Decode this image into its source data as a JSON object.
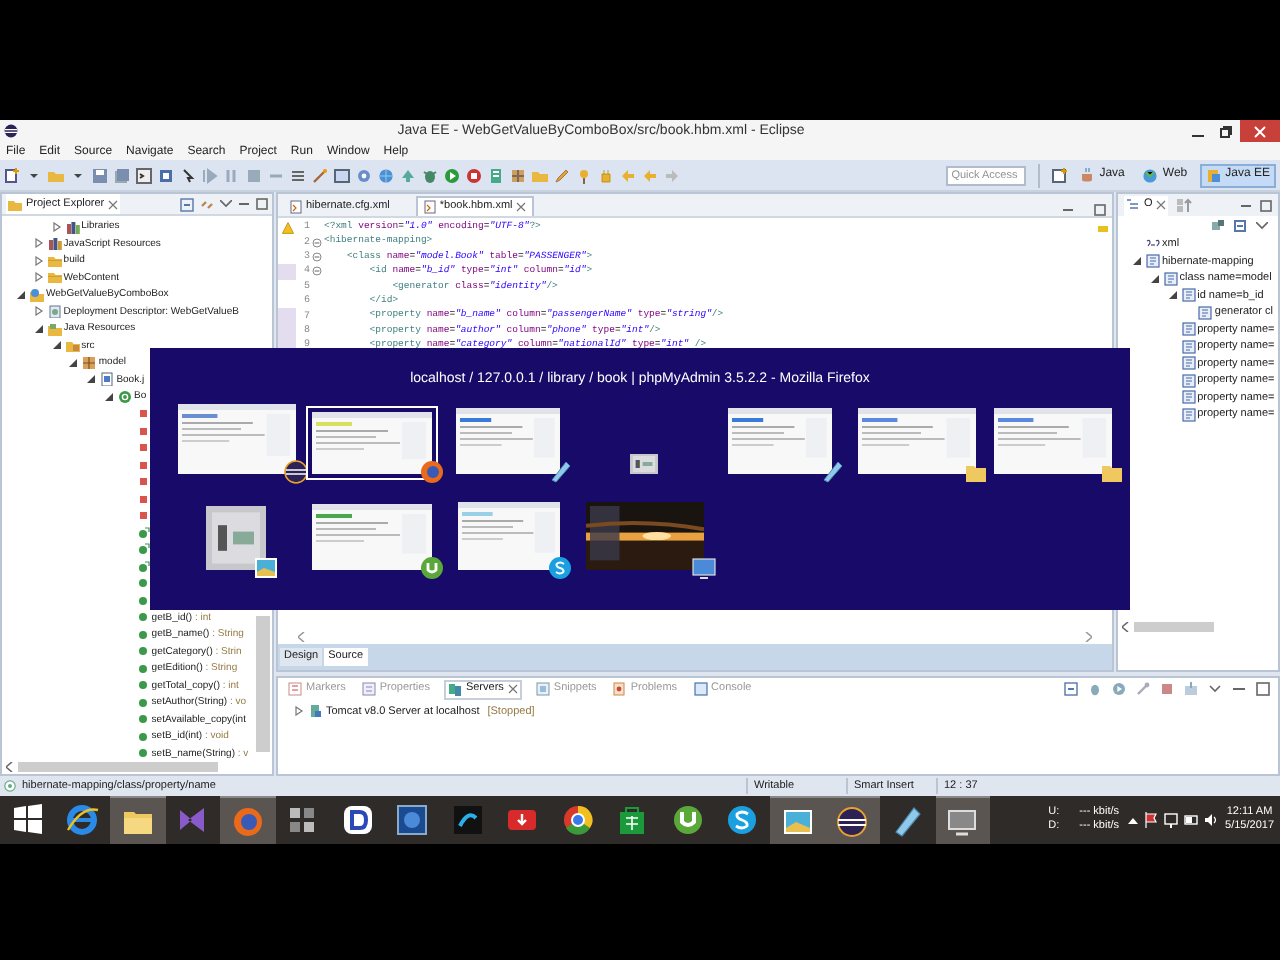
{
  "window": {
    "title": "Java EE - WebGetValueByComboBox/src/book.hbm.xml - Eclipse"
  },
  "menu": [
    "File",
    "Edit",
    "Source",
    "Navigate",
    "Search",
    "Project",
    "Run",
    "Window",
    "Help"
  ],
  "quick_access": {
    "placeholder": "Quick Access"
  },
  "perspectives": [
    {
      "label": "Java",
      "kind": "java",
      "selected": false
    },
    {
      "label": "Web",
      "kind": "web",
      "selected": false
    },
    {
      "label": "Java EE",
      "kind": "javaee",
      "selected": true
    }
  ],
  "project_explorer": {
    "title": "Project Explorer",
    "tree": [
      {
        "children": [
          {
            "children": [
              {
                "label": "Libraries",
                "kind": "library",
                "expanded": false
              }
            ]
          },
          {
            "label": "JavaScript Resources",
            "kind": "jsres",
            "expanded": false
          },
          {
            "label": "build",
            "kind": "folder",
            "expanded": false
          },
          {
            "label": "WebContent",
            "kind": "folder",
            "expanded": false
          }
        ]
      },
      {
        "label": "WebGetValueByComboBox",
        "kind": "project",
        "expanded": true,
        "children": [
          {
            "label": "Deployment Descriptor: WebGetValueB",
            "kind": "descriptor",
            "expanded": false
          },
          {
            "label": "Java Resources",
            "kind": "javares",
            "expanded": true,
            "children": [
              {
                "label": "src",
                "kind": "src",
                "expanded": true,
                "children": [
                  {
                    "label": "model",
                    "kind": "package",
                    "expanded": true,
                    "children": [
                      {
                        "label": "Book.j",
                        "kind": "javafile",
                        "expanded": true,
                        "children": [
                          {
                            "label": "Bo",
                            "kind": "class",
                            "expanded": true,
                            "children": [
                              {
                                "kind": "field"
                              },
                              {
                                "kind": "field"
                              },
                              {
                                "kind": "field"
                              },
                              {
                                "kind": "field"
                              },
                              {
                                "kind": "field"
                              },
                              {
                                "kind": "field"
                              },
                              {
                                "kind": "field"
                              },
                              {
                                "kind": "constructor"
                              },
                              {
                                "kind": "constructor"
                              },
                              {
                                "kind": "constructor"
                              },
                              {
                                "kind": "method"
                              },
                              {
                                "kind": "method"
                              },
                              {
                                "kind": "method",
                                "label": "getB_id()",
                                "type": " : int"
                              },
                              {
                                "kind": "method",
                                "label": "getB_name()",
                                "type": " : String"
                              },
                              {
                                "kind": "method",
                                "label": "getCategory()",
                                "type": " : Strin"
                              },
                              {
                                "kind": "method",
                                "label": "getEdition()",
                                "type": " : String"
                              },
                              {
                                "kind": "method",
                                "label": "getTotal_copy()",
                                "type": " : int"
                              },
                              {
                                "kind": "method",
                                "label": "setAuthor(String)",
                                "type": " : vo"
                              },
                              {
                                "kind": "method",
                                "label": "setAvailable_copy(int"
                              },
                              {
                                "kind": "method",
                                "label": "setB_id(int)",
                                "type": " : void"
                              },
                              {
                                "kind": "method",
                                "label": "setB_name(String)",
                                "type": " : v"
                              }
                            ]
                          }
                        ]
                      }
                    ]
                  }
                ]
              }
            ]
          }
        ]
      }
    ]
  },
  "editor": {
    "tabs": [
      {
        "label": "hibernate.cfg.xml",
        "selected": false
      },
      {
        "label": "*book.hbm.xml",
        "selected": true
      }
    ],
    "lines": [
      {
        "number": "1",
        "text": "<?xml version=\"1.0\" encoding=\"UTF-8\"?>",
        "warning": true,
        "fold": false,
        "changed": false
      },
      {
        "number": "2",
        "text": "<hibernate-mapping>",
        "warning": false,
        "fold": true,
        "changed": false
      },
      {
        "number": "3",
        "text": "    <class name=\"model.Book\" table=\"PASSENGER\">",
        "warning": false,
        "fold": true,
        "changed": false
      },
      {
        "number": "4",
        "text": "        <id name=\"b_id\" type=\"int\" column=\"id\">",
        "warning": false,
        "fold": true,
        "changed": true
      },
      {
        "number": "5",
        "text": "            <generator class=\"identity\"/>",
        "warning": false,
        "fold": false,
        "changed": false
      },
      {
        "number": "6",
        "text": "        </id>",
        "warning": false,
        "fold": false,
        "changed": false
      },
      {
        "number": "7",
        "text": "        <property name=\"b_name\" column=\"passengerName\" type=\"string\"/>",
        "warning": false,
        "fold": false,
        "changed": true
      },
      {
        "number": "8",
        "text": "        <property name=\"author\" column=\"phone\" type=\"int\"/>",
        "warning": false,
        "fold": false,
        "changed": true
      },
      {
        "number": "9",
        "text": "        <property name=\"category\" column=\"nationalId\" type=\"int\" />",
        "warning": false,
        "fold": false,
        "changed": true
      }
    ],
    "bottom_tabs": [
      {
        "label": "Design",
        "selected": false
      },
      {
        "label": "Source",
        "selected": true
      }
    ]
  },
  "outline": {
    "tab": "O",
    "tree": [
      {
        "label": "xml",
        "kind": "pi"
      },
      {
        "label": "hibernate-mapping",
        "kind": "element",
        "expanded": true,
        "children": [
          {
            "label": "class name=model",
            "kind": "element",
            "expanded": true,
            "children": [
              {
                "label": "id name=b_id",
                "kind": "element",
                "expanded": true,
                "children": [
                  {
                    "label": "generator cl",
                    "kind": "element"
                  }
                ]
              },
              {
                "label": "property name=",
                "kind": "element"
              },
              {
                "label": "property name=",
                "kind": "element"
              },
              {
                "label": "property name=",
                "kind": "element"
              },
              {
                "label": "property name=",
                "kind": "element"
              },
              {
                "label": "property name=",
                "kind": "element"
              },
              {
                "label": "property name=",
                "kind": "element"
              }
            ]
          }
        ]
      }
    ]
  },
  "bottom_panel": {
    "tabs": [
      {
        "label": "Markers",
        "kind": "markers",
        "selected": false
      },
      {
        "label": "Properties",
        "kind": "properties",
        "selected": false
      },
      {
        "label": "Servers",
        "kind": "servers",
        "selected": true
      },
      {
        "label": "Snippets",
        "kind": "snippets",
        "selected": false
      },
      {
        "label": "Problems",
        "kind": "problems",
        "selected": false
      },
      {
        "label": "Console",
        "kind": "console",
        "selected": false
      }
    ],
    "servers": [
      {
        "label": "Tomcat v8.0 Server at localhost",
        "status": "[Stopped]",
        "expanded": false
      }
    ]
  },
  "status_bar": {
    "path": "hibernate-mapping/class/property/name",
    "mode": "Writable",
    "insert": "Smart Insert",
    "position": "12 : 37"
  },
  "switcher": {
    "title": "localhost / 127.0.0.1 / library / book | phpMyAdmin 3.5.2.2 - Mozilla Firefox",
    "rows": [
      [
        {
          "kind": "eclipse",
          "selected": false
        },
        {
          "kind": "firefox",
          "selected": true
        },
        {
          "kind": "notepad",
          "selected": false
        },
        {
          "kind": "tiny",
          "selected": false
        },
        {
          "kind": "notepad",
          "selected": false
        },
        {
          "kind": "folder",
          "selected": false
        },
        {
          "kind": "folder",
          "selected": false
        }
      ],
      [
        {
          "kind": "photos",
          "selected": false
        },
        {
          "kind": "utorrent",
          "selected": false
        },
        {
          "kind": "skype",
          "selected": false
        },
        {
          "kind": "desktop",
          "selected": false
        }
      ]
    ]
  },
  "taskbar": {
    "apps": [
      {
        "kind": "start",
        "running": false
      },
      {
        "kind": "ie",
        "running": false
      },
      {
        "kind": "folder",
        "running": true
      },
      {
        "kind": "vs",
        "running": false
      },
      {
        "kind": "firefox",
        "running": true
      },
      {
        "kind": "grid",
        "running": false
      },
      {
        "kind": "dapp",
        "running": false
      },
      {
        "kind": "bluesquare",
        "running": false
      },
      {
        "kind": "telenor",
        "running": false
      },
      {
        "kind": "download",
        "running": false
      },
      {
        "kind": "chrome",
        "running": false
      },
      {
        "kind": "store",
        "running": false
      },
      {
        "kind": "utorrent",
        "running": false
      },
      {
        "kind": "skype",
        "running": false
      },
      {
        "kind": "photos",
        "running": true
      },
      {
        "kind": "eclipse",
        "running": true
      },
      {
        "kind": "notepad",
        "running": false
      },
      {
        "kind": "screen",
        "running": true
      }
    ],
    "net": [
      {
        "label": "U:",
        "rate": "--- kbit/s"
      },
      {
        "label": "D:",
        "rate": "--- kbit/s"
      }
    ],
    "time": "12:11 AM",
    "date": "5/15/2017"
  }
}
